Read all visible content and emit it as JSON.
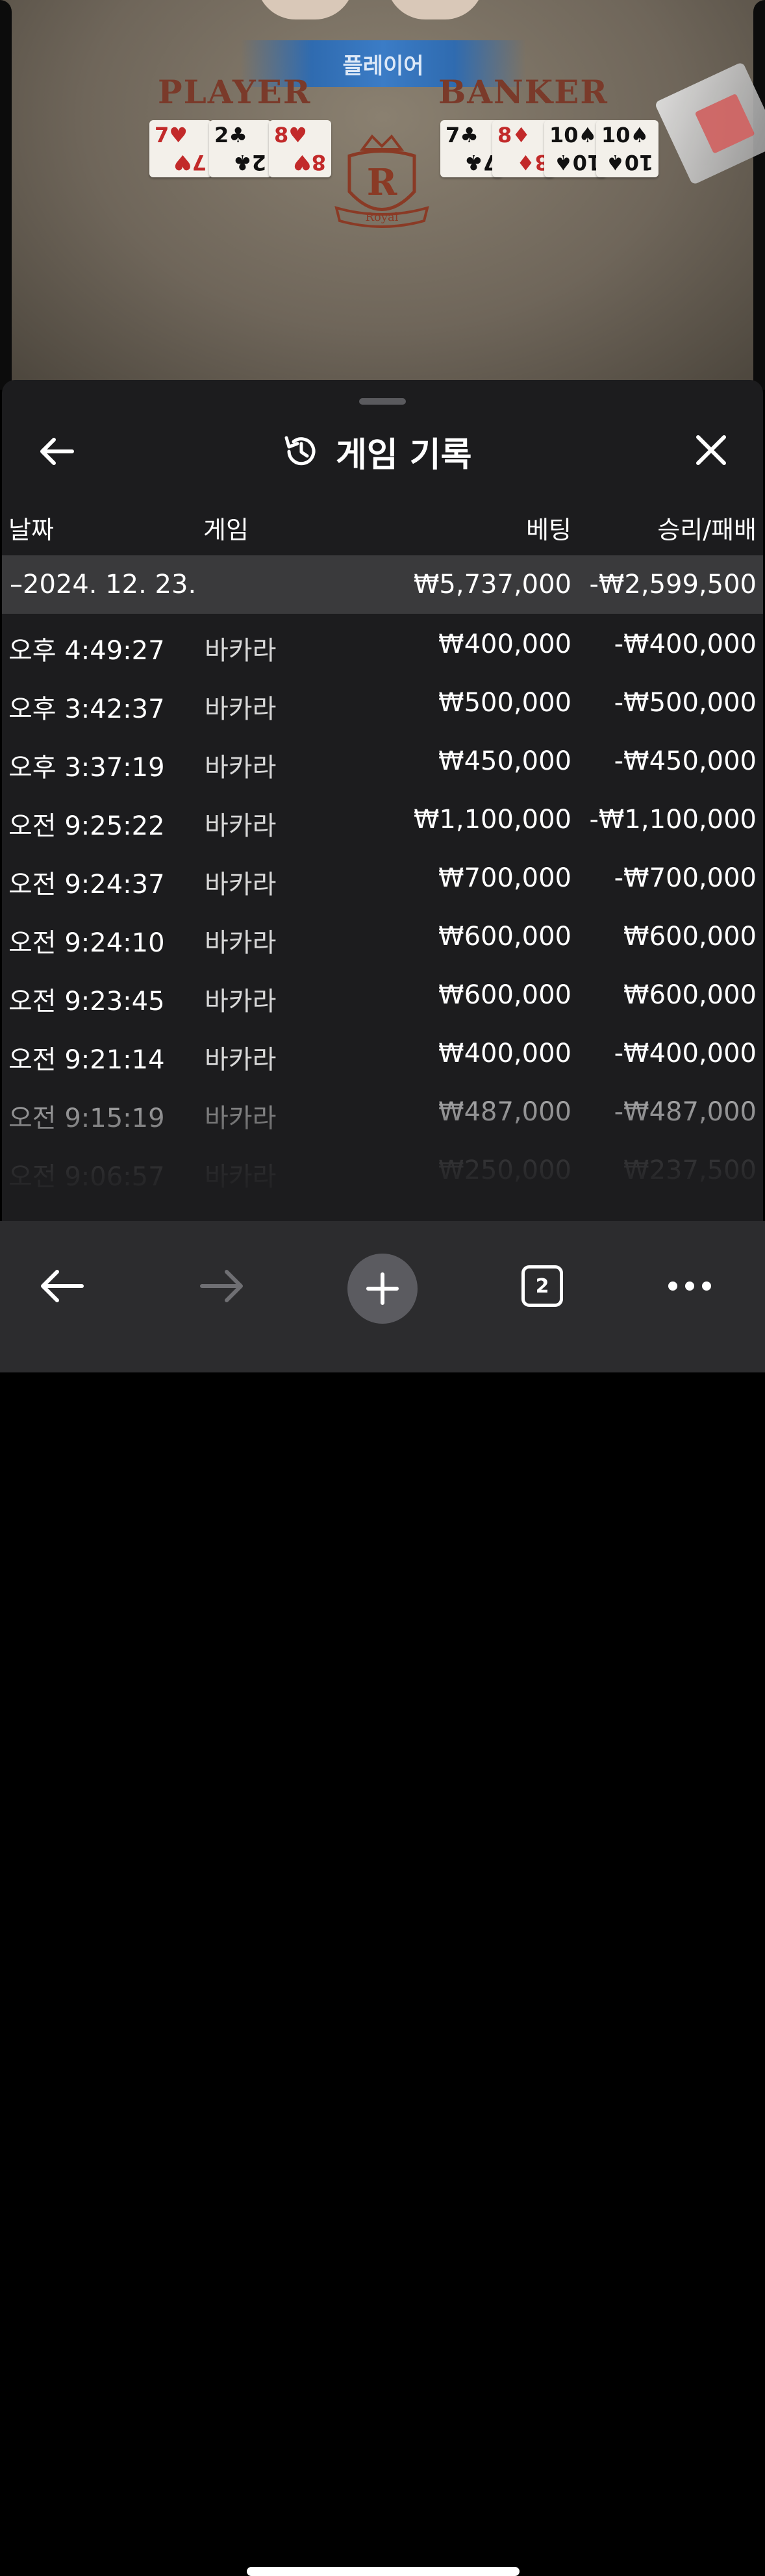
{
  "table": {
    "result_banner": "플레이어",
    "player_label": "PLAYER",
    "banker_label": "BANKER",
    "logo_letter": "R",
    "logo_text": "Royal",
    "player_cards": [
      {
        "rank": "7",
        "suit": "♥",
        "color": "red"
      },
      {
        "rank": "2",
        "suit": "♣",
        "color": "black"
      },
      {
        "rank": "8",
        "suit": "♥",
        "color": "red"
      }
    ],
    "banker_cards": [
      {
        "rank": "7",
        "suit": "♣",
        "color": "black"
      },
      {
        "rank": "8",
        "suit": "♦",
        "color": "red"
      },
      {
        "rank": "10",
        "suit": "♠",
        "color": "black"
      },
      {
        "rank": "10",
        "suit": "♠",
        "color": "black"
      }
    ]
  },
  "sheet": {
    "title": "게임 기록",
    "icons": {
      "back": "back-arrow-icon",
      "history": "history-icon",
      "close": "close-icon"
    },
    "columns": {
      "date": "날짜",
      "game": "게임",
      "bet": "베팅",
      "win_loss": "승리/패배"
    },
    "group": {
      "date": "–2024. 12. 23.",
      "bet": "₩5,737,000",
      "win_loss": "-₩2,599,500"
    },
    "rows": [
      {
        "time": "오후 4:49:27",
        "game": "바카라",
        "bet": "₩400,000",
        "win_loss": "-₩400,000"
      },
      {
        "time": "오후 3:42:37",
        "game": "바카라",
        "bet": "₩500,000",
        "win_loss": "-₩500,000"
      },
      {
        "time": "오후 3:37:19",
        "game": "바카라",
        "bet": "₩450,000",
        "win_loss": "-₩450,000"
      },
      {
        "time": "오전 9:25:22",
        "game": "바카라",
        "bet": "₩1,100,000",
        "win_loss": "-₩1,100,000"
      },
      {
        "time": "오전 9:24:37",
        "game": "바카라",
        "bet": "₩700,000",
        "win_loss": "-₩700,000"
      },
      {
        "time": "오전 9:24:10",
        "game": "바카라",
        "bet": "₩600,000",
        "win_loss": "₩600,000"
      },
      {
        "time": "오전 9:23:45",
        "game": "바카라",
        "bet": "₩600,000",
        "win_loss": "₩600,000"
      },
      {
        "time": "오전 9:21:14",
        "game": "바카라",
        "bet": "₩400,000",
        "win_loss": "-₩400,000"
      },
      {
        "time": "오전 9:15:19",
        "game": "바카라",
        "bet": "₩487,000",
        "win_loss": "-₩487,000"
      },
      {
        "time": "오전 9:06:57",
        "game": "바카라",
        "bet": "₩250,000",
        "win_loss": "₩237,500"
      }
    ]
  },
  "toolbar": {
    "tab_count": "2",
    "icons": {
      "back": "back-arrow-icon",
      "forward": "forward-arrow-icon",
      "new_tab": "plus-icon",
      "tabs": "tabs-icon",
      "more": "more-icon"
    }
  }
}
